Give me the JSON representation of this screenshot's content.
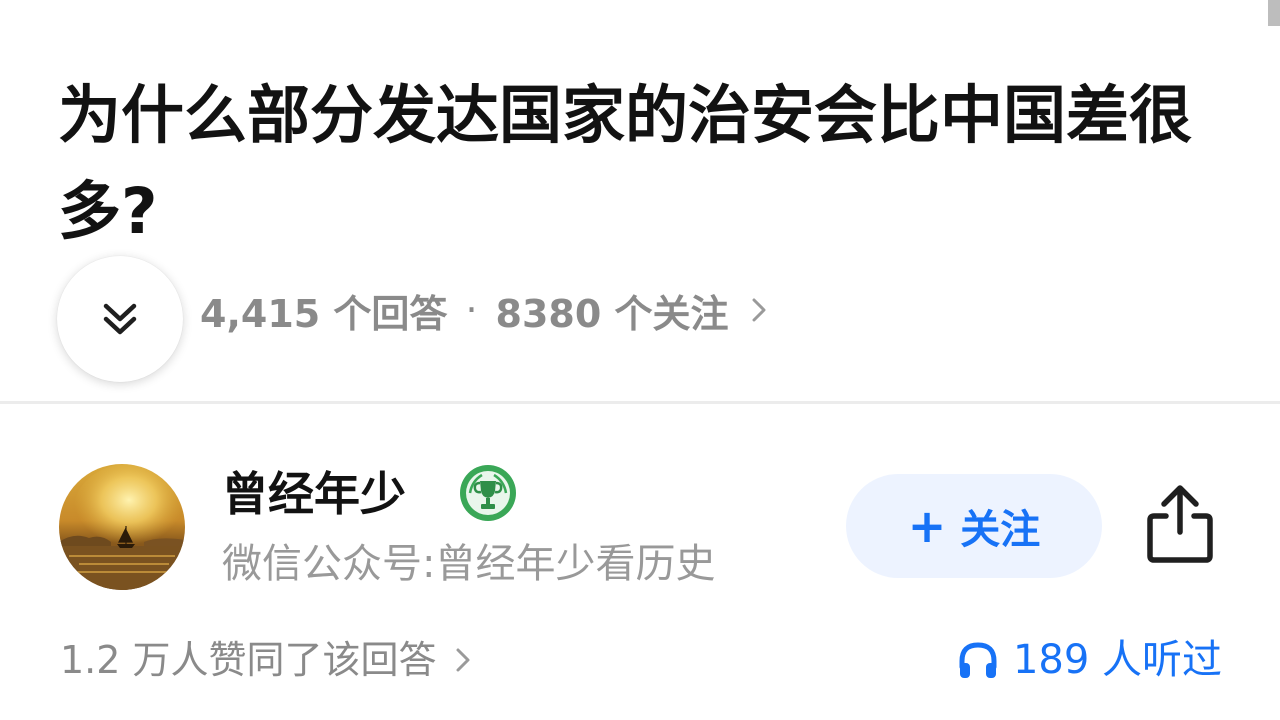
{
  "question": {
    "title": "为什么部分发达国家的治安会比中国差很多?",
    "stats": {
      "answers": "4,415 个回答",
      "separator": "·",
      "followers": "8380 个关注"
    }
  },
  "answer": {
    "author": {
      "name": "曾经年少",
      "bio": "微信公众号:曾经年少看历史"
    },
    "follow_button": {
      "icon": "+",
      "label": "关注"
    },
    "likes_text": "1.2 万人赞同了该回答",
    "listens_text": "189 人听过"
  },
  "icons": {
    "collapse": "double-chevron-down-icon",
    "chevron": "chevron-right-icon",
    "badge": "trophy-badge-icon",
    "share": "share-icon",
    "headphone": "headphone-icon"
  },
  "colors": {
    "accent": "#1772f6",
    "follow_bg": "#edf3ff",
    "badge_green": "#3aa757",
    "muted_text": "#8a8a8a"
  }
}
